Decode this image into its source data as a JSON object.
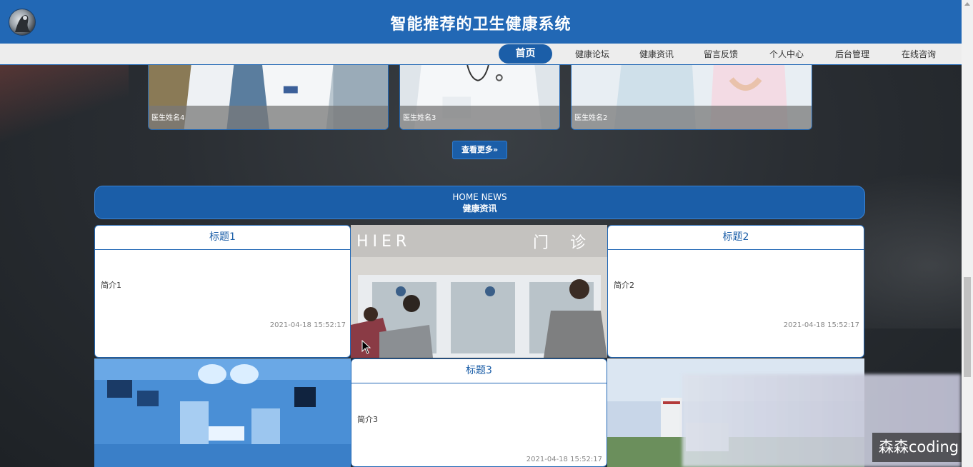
{
  "header": {
    "title": "智能推荐的卫生健康系统",
    "logo_icon": "avatar-logo-icon"
  },
  "nav": {
    "items": [
      {
        "label": "首页",
        "active": true
      },
      {
        "label": "健康论坛",
        "active": false
      },
      {
        "label": "健康资讯",
        "active": false
      },
      {
        "label": "留言反馈",
        "active": false
      },
      {
        "label": "个人中心",
        "active": false
      },
      {
        "label": "后台管理",
        "active": false
      },
      {
        "label": "在线咨询",
        "active": false
      }
    ]
  },
  "doctors": {
    "cards": [
      {
        "name": "医生姓名4"
      },
      {
        "name": "医生姓名3"
      },
      {
        "name": "医生姓名2"
      }
    ],
    "more_label": "查看更多",
    "more_icon": "double-chevron-right-icon"
  },
  "news_section": {
    "title_en": "HOME NEWS",
    "title_zh": "健康资讯",
    "items": [
      {
        "title": "标题1",
        "intro": "简介1",
        "date": "2021-04-18 15:52:17"
      },
      {
        "title": "标题2",
        "intro": "简介2",
        "date": "2021-04-18 15:52:17"
      },
      {
        "title": "标题3",
        "intro": "简介3",
        "date": "2021-04-18 15:52:17"
      }
    ],
    "clinic_photo_sign": "HIER 门 诊"
  },
  "watermark": {
    "text": "森森coding"
  },
  "colors": {
    "primary": "#2268b5",
    "primary_dark": "#1b5ea8",
    "nav_bg": "#ededed",
    "background": "#2a2e33"
  }
}
